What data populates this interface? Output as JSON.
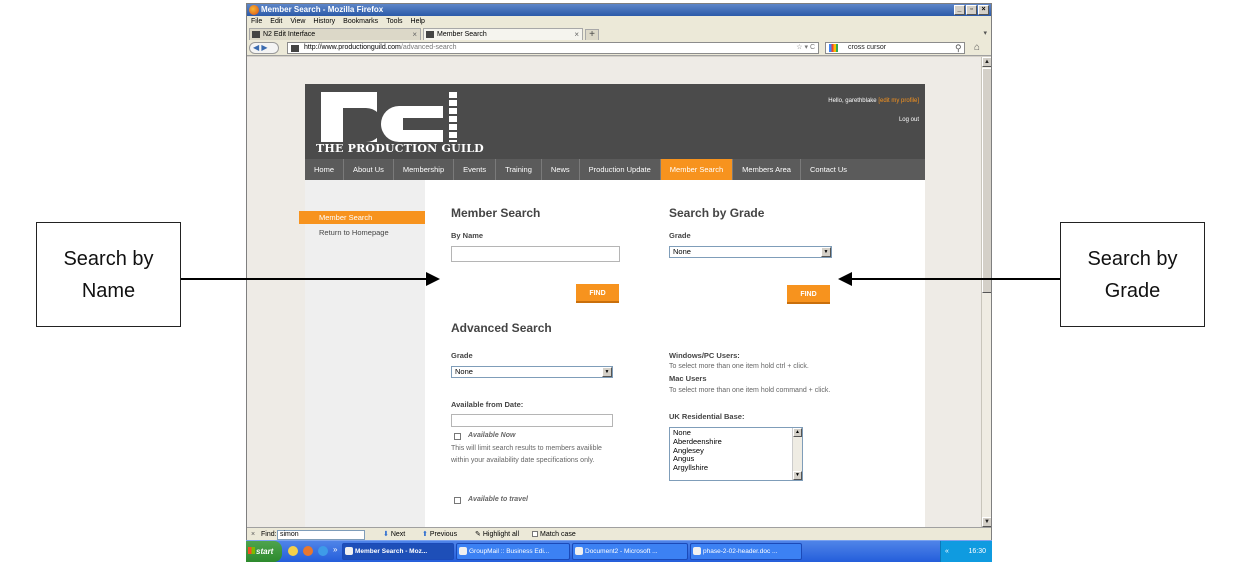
{
  "browser": {
    "window_title": "Member Search - Mozilla Firefox",
    "menu": [
      "File",
      "Edit",
      "View",
      "History",
      "Bookmarks",
      "Tools",
      "Help"
    ],
    "tabs": [
      {
        "label": "N2 Edit Interface",
        "active": false
      },
      {
        "label": "Member Search",
        "active": true
      }
    ],
    "url_domain": "http://www.productionguild.com",
    "url_path": "/advanced-search",
    "search_value": "cross cursor"
  },
  "site": {
    "logo_text": "THE PRODUCTION GUILD",
    "hello": "Hello, garethblake",
    "edit_profile": "[edit my profile]",
    "logout": "Log out",
    "nav": [
      "Home",
      "About Us",
      "Membership",
      "Events",
      "Training",
      "News",
      "Production Update",
      "Member Search",
      "Members Area",
      "Contact Us"
    ],
    "nav_active": "Member Search",
    "sidebar": {
      "active_item": "Member Search",
      "item2": "Return to Homepage"
    },
    "member_search": {
      "title": "Member Search",
      "by_name_label": "By Name",
      "name_value": "",
      "find_label": "FIND"
    },
    "grade_search": {
      "title": "Search by Grade",
      "grade_label": "Grade",
      "grade_value": "None",
      "find_label": "FIND"
    },
    "advanced": {
      "title": "Advanced Search",
      "grade_label": "Grade",
      "grade_value": "None",
      "avail_label": "Available from Date:",
      "avail_now": "Available Now",
      "avail_note_1": "This will limit search results to members availible",
      "avail_note_2": "within your availability date specifications only.",
      "travel_label": "Available to travel",
      "win_label": "Windows/PC Users:",
      "win_note": "To select more than one item hold ctrl + click.",
      "mac_label": "Mac Users",
      "mac_note": "To select more than one item hold command + click.",
      "uk_label": "UK Residential Base:",
      "uk_options": [
        "None",
        "Aberdeenshire",
        "Anglesey",
        "Angus",
        "Argyllshire"
      ]
    }
  },
  "findbar": {
    "label": "Find:",
    "value": "simon",
    "next": "Next",
    "previous": "Previous",
    "highlight": "Highlight all",
    "match_case": "Match case"
  },
  "taskbar": {
    "start": "start",
    "tasks": [
      "Member Search - Moz...",
      "GroupMail :: Business Edi...",
      "Document2 - Microsoft ...",
      "phase-2-02-header.doc ..."
    ],
    "time": "16:30"
  },
  "callouts": {
    "left_line1": "Search by",
    "left_line2": "Name",
    "right_line1": "Search by",
    "right_line2": "Grade"
  }
}
